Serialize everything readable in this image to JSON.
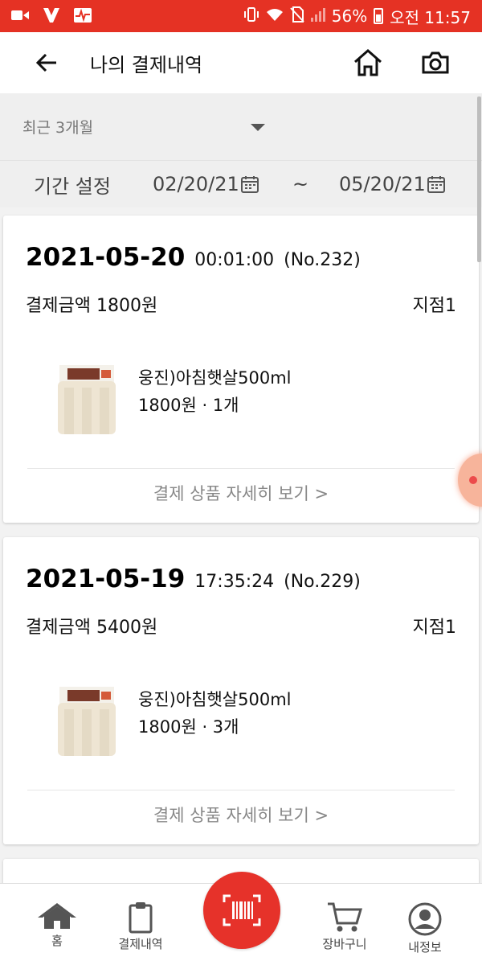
{
  "status_bar": {
    "battery": "56%",
    "time": "오전 11:57"
  },
  "header": {
    "title": "나의 결제내역"
  },
  "filter": {
    "period_selected": "최근 3개월",
    "range_label": "기간 설정",
    "start_date": "02/20/21",
    "separator": "~",
    "end_date": "05/20/21"
  },
  "orders": [
    {
      "date": "2021-05-20",
      "time": "00:01:00",
      "number": "(No.232)",
      "amount": "결제금액 1800원",
      "store": "지점1",
      "product_name": "웅진)아침햇살500ml",
      "product_qty": "1800원 · 1개",
      "detail_link": "결제 상품 자세히 보기 >"
    },
    {
      "date": "2021-05-19",
      "time": "17:35:24",
      "number": "(No.229)",
      "amount": "결제금액 5400원",
      "store": "지점1",
      "product_name": "웅진)아침햇살500ml",
      "product_qty": "1800원 · 3개",
      "detail_link": "결제 상품 자세히 보기 >"
    }
  ],
  "bottom_nav": {
    "home": "홈",
    "history": "결제내역",
    "cart": "장바구니",
    "profile": "내정보"
  },
  "colors": {
    "brand_red": "#e53224",
    "background": "#f2f2f2"
  }
}
